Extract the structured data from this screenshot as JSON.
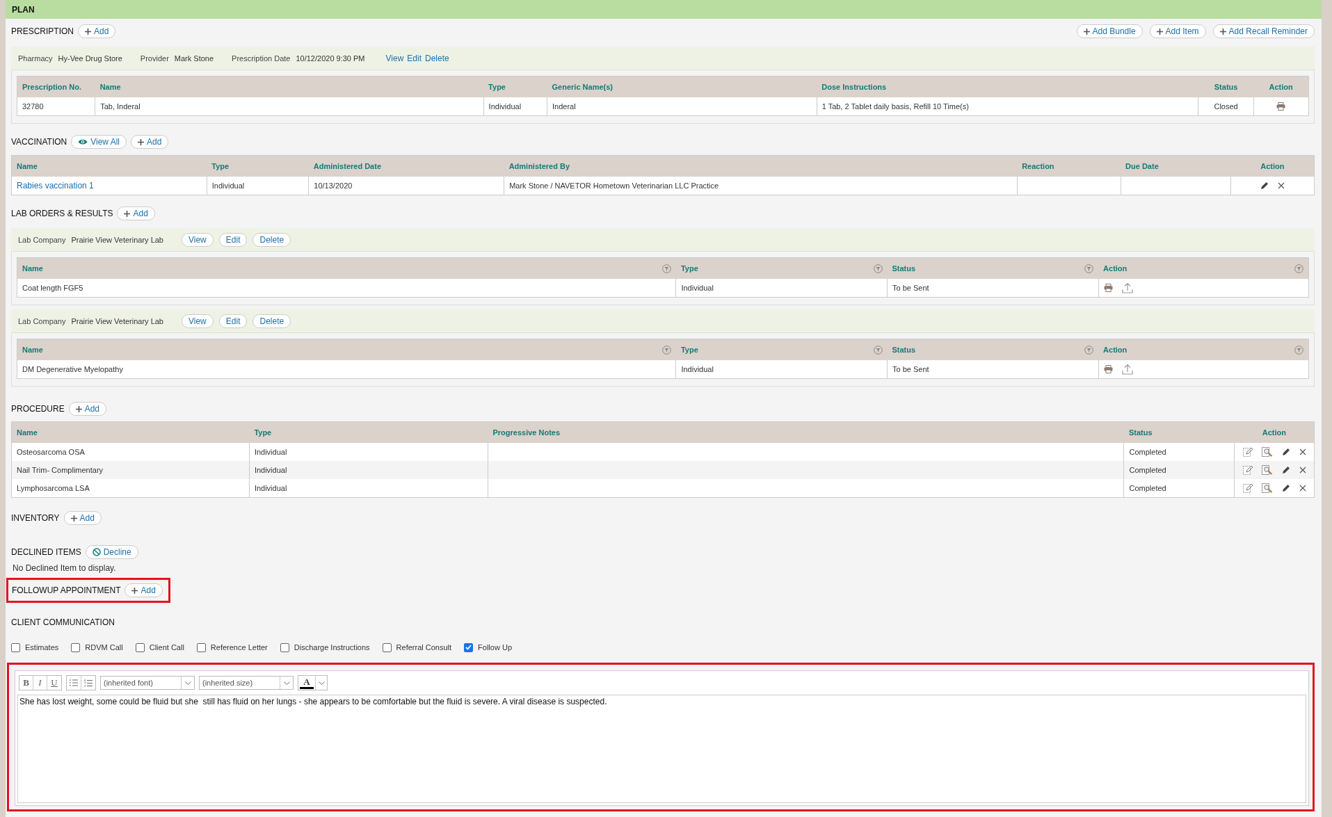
{
  "header": {
    "title": "PLAN"
  },
  "prescription": {
    "title": "PRESCRIPTION",
    "add_label": "Add",
    "actions": [
      "Add Bundle",
      "Add Item",
      "Add Recall Reminder"
    ],
    "record": {
      "fields": [
        {
          "label": "Pharmacy",
          "value": "Hy-Vee Drug Store"
        },
        {
          "label": "Provider",
          "value": "Mark Stone"
        },
        {
          "label": "Prescription Date",
          "value": "10/12/2020 9:30 PM"
        }
      ],
      "links": [
        "View",
        "Edit",
        "Delete"
      ],
      "table": {
        "columns": [
          "Prescription No.",
          "Name",
          "Type",
          "Generic Name(s)",
          "Dose Instructions",
          "Status",
          "Action"
        ],
        "rows": [
          {
            "cells": [
              "32780",
              "Tab, Inderal",
              "Individual",
              "Inderal",
              "1 Tab, 2 Tablet daily basis, Refill 10 Time(s)",
              "Closed"
            ],
            "actions": [
              {
                "kind": "print"
              }
            ]
          }
        ]
      }
    }
  },
  "vaccination": {
    "title": "VACCINATION",
    "view_all_label": "View All",
    "add_label": "Add",
    "table": {
      "columns": [
        "Name",
        "Type",
        "Administered Date",
        "Administered By",
        "Reaction",
        "Due Date",
        "Action"
      ],
      "rows": [
        {
          "cells": [
            {
              "text": "Rabies vaccination 1",
              "kind": "link"
            },
            "Individual",
            "10/13/2020",
            "Mark Stone / NAVETOR Hometown Veterinarian LLC Practice",
            "",
            ""
          ],
          "actions": [
            {
              "kind": "edit"
            },
            {
              "kind": "delete"
            }
          ]
        }
      ]
    }
  },
  "lab_orders": {
    "title": "LAB ORDERS & RESULTS",
    "add_label": "Add",
    "orders": [
      {
        "company_label": "Lab Company",
        "company": "Prairie View Veterinary Lab",
        "buttons": [
          "View",
          "Edit",
          "Delete"
        ],
        "table": {
          "columns": [
            "Name",
            "Type",
            "Status",
            "Action"
          ],
          "rows": [
            {
              "cells": [
                "Coat length FGF5",
                "Individual",
                "To be Sent"
              ],
              "actions": [
                {
                  "kind": "print"
                },
                {
                  "kind": "upload"
                }
              ]
            }
          ]
        }
      },
      {
        "company_label": "Lab Company",
        "company": "Prairie View Veterinary Lab",
        "buttons": [
          "View",
          "Edit",
          "Delete"
        ],
        "table": {
          "columns": [
            "Name",
            "Type",
            "Status",
            "Action"
          ],
          "rows": [
            {
              "cells": [
                "DM Degenerative Myelopathy",
                "Individual",
                "To be Sent"
              ],
              "actions": [
                {
                  "kind": "print"
                },
                {
                  "kind": "upload"
                }
              ]
            }
          ]
        }
      }
    ]
  },
  "procedure": {
    "title": "PROCEDURE",
    "add_label": "Add",
    "table": {
      "columns": [
        "Name",
        "Type",
        "Progressive Notes",
        "Status",
        "Action"
      ],
      "rows": [
        {
          "cells": [
            "Osteosarcoma OSA",
            "Individual",
            "",
            "Completed"
          ],
          "actions": [
            {
              "kind": "notes"
            },
            {
              "kind": "preview"
            },
            {
              "kind": "edit"
            },
            {
              "kind": "delete"
            }
          ]
        },
        {
          "cells": [
            "Nail Trim- Complimentary",
            "Individual",
            "",
            "Completed"
          ],
          "actions": [
            {
              "kind": "notes"
            },
            {
              "kind": "preview"
            },
            {
              "kind": "edit"
            },
            {
              "kind": "delete"
            }
          ]
        },
        {
          "cells": [
            "Lymphosarcoma LSA",
            "Individual",
            "",
            "Completed"
          ],
          "actions": [
            {
              "kind": "notes"
            },
            {
              "kind": "preview"
            },
            {
              "kind": "edit"
            },
            {
              "kind": "delete"
            }
          ]
        }
      ]
    }
  },
  "inventory": {
    "title": "INVENTORY",
    "add_label": "Add"
  },
  "declined_items": {
    "title": "DECLINED ITEMS",
    "decline_label": "Decline",
    "empty_text": "No Declined Item to display."
  },
  "followup_appointment": {
    "title": "FOLLOWUP APPOINTMENT",
    "add_label": "Add",
    "highlighted": true
  },
  "client_communication": {
    "title": "CLIENT COMMUNICATION",
    "options": [
      {
        "label": "Estimates",
        "checked": false
      },
      {
        "label": "RDVM Call",
        "checked": false
      },
      {
        "label": "Client Call",
        "checked": false
      },
      {
        "label": "Reference Letter",
        "checked": false
      },
      {
        "label": "Discharge Instructions",
        "checked": false
      },
      {
        "label": "Referral Consult",
        "checked": false
      },
      {
        "label": "Follow Up",
        "checked": true
      }
    ]
  },
  "notes_editor": {
    "highlighted": true,
    "format_buttons": [
      {
        "label": "B",
        "kind": "bold"
      },
      {
        "label": "I",
        "kind": "italic"
      },
      {
        "label": "U",
        "kind": "underline"
      }
    ],
    "font": "(inherited font)",
    "size": "(inherited size)",
    "color_button": "A",
    "text": "She has lost weight, some could be fluid but she  still has fluid on her lungs - she appears to be comfortable but the fluid is severe. A viral disease is suspected."
  }
}
